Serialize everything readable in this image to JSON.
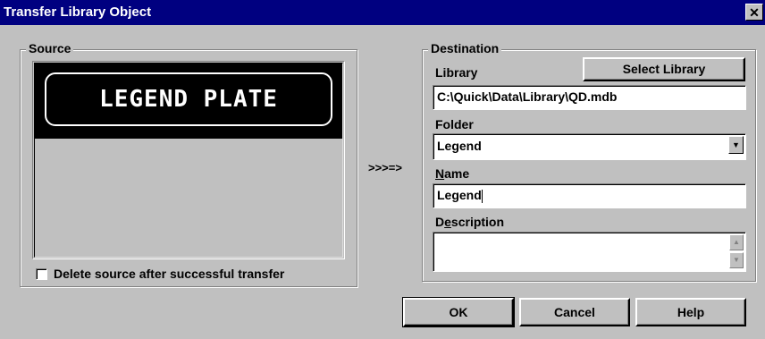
{
  "window": {
    "title": "Transfer Library Object",
    "close_glyph": "✕"
  },
  "source": {
    "label": "Source",
    "preview_text": "LEGEND PLATE",
    "delete_checkbox_label": "Delete source after successful transfer",
    "delete_checked": false
  },
  "arrow_text": ">>>=>",
  "destination": {
    "label": "Destination",
    "library_label": "Library",
    "select_library_button": "Select Library",
    "library_path": "C:\\Quick\\Data\\Library\\QD.mdb",
    "folder_label": "Folder",
    "folder_value": "Legend",
    "name_label_prefix": "N",
    "name_label_rest": "ame",
    "name_value": "Legend",
    "description_label_prefix": "D",
    "description_label_underlined": "e",
    "description_label_rest": "scription",
    "description_value": ""
  },
  "buttons": {
    "ok": "OK",
    "cancel": "Cancel",
    "help": "Help"
  },
  "icons": {
    "dropdown": "chevron-down-icon",
    "scroll_up": "scroll-up-icon",
    "scroll_down": "scroll-down-icon"
  }
}
